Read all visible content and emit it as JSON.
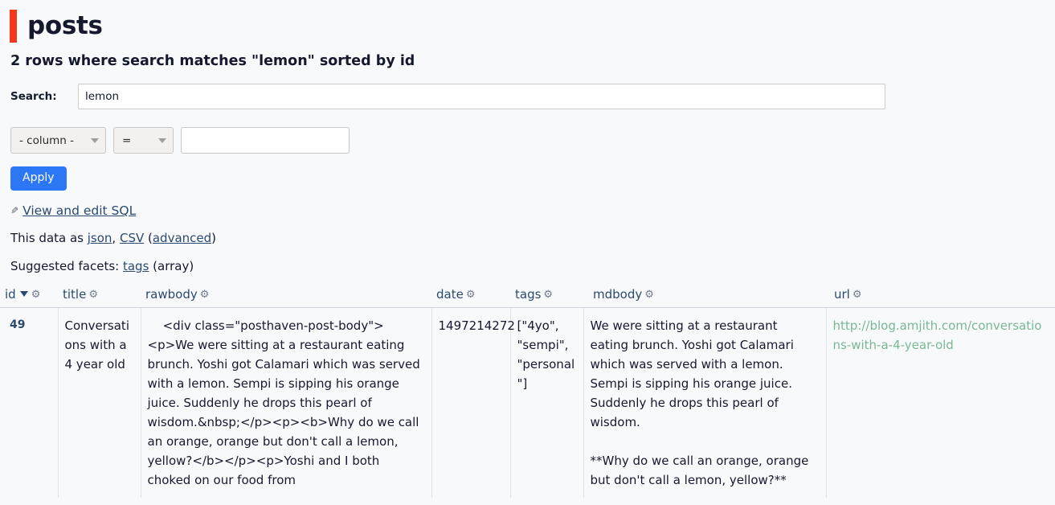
{
  "header": {
    "title": "posts",
    "accent_color": "#f4361c"
  },
  "summary": "2 rows where search matches \"lemon\" sorted by id",
  "search": {
    "label": "Search:",
    "value": "lemon",
    "placeholder": ""
  },
  "filter": {
    "column_select": "- column -",
    "operator_select": "=",
    "value": "",
    "value_placeholder": "",
    "apply_label": "Apply"
  },
  "sql_link": {
    "icon": "pencil-icon",
    "label": "View and edit SQL"
  },
  "export": {
    "prefix": "This data as ",
    "json_label": "json",
    "separator": ", ",
    "csv_label": "CSV",
    "open_paren": " (",
    "advanced_label": "advanced",
    "close_paren": ")"
  },
  "facets": {
    "prefix": "Suggested facets: ",
    "link_label": "tags",
    "suffix": " (array)"
  },
  "table": {
    "columns": [
      {
        "label": "id",
        "sorted": true,
        "gear": "gear-icon"
      },
      {
        "label": "title",
        "sorted": false,
        "gear": "gear-icon"
      },
      {
        "label": "rawbody",
        "sorted": false,
        "gear": "gear-icon"
      },
      {
        "label": "date",
        "sorted": false,
        "gear": "gear-icon"
      },
      {
        "label": "tags",
        "sorted": false,
        "gear": "gear-icon"
      },
      {
        "label": "mdbody",
        "sorted": false,
        "gear": "gear-icon"
      },
      {
        "label": "url",
        "sorted": false,
        "gear": "gear-icon"
      }
    ],
    "rows": [
      {
        "id": "49",
        "title": "Conversations with a 4 year old",
        "rawbody": "    <div class=\"posthaven-post-body\"><p>We were sitting at a restaurant eating brunch. Yoshi got Calamari which was served with a lemon. Sempi is sipping his orange juice. Suddenly he drops this pearl of wisdom.&nbsp;</p><p><b>Why do we call an orange, orange but don't call a lemon, yellow?</b></p><p>Yoshi and I both choked on our food from",
        "date": "1497214272",
        "tags": "[\"4yo\", \"sempi\", \"personal\"]",
        "mdbody": "We were sitting at a restaurant eating brunch. Yoshi got Calamari which was served with a lemon. Sempi is sipping his orange juice. Suddenly he drops this pearl of wisdom.\n\n**Why do we call an orange, orange but don't call a lemon, yellow?**",
        "url": "http://blog.amjith.com/conversations-with-a-4-year-old"
      }
    ]
  },
  "colors": {
    "accent": "#f4361c",
    "link": "#2b4a6f",
    "url_link": "#79b896",
    "button": "#2b77f5",
    "page_bg": "#f8f9fb"
  }
}
